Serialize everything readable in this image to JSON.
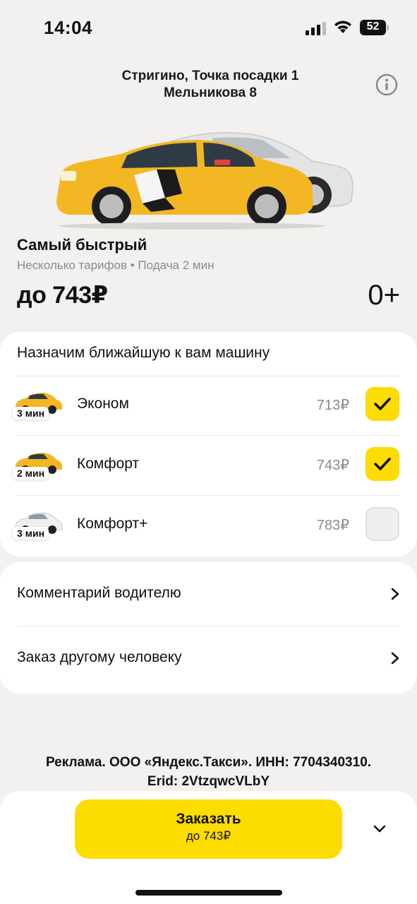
{
  "status": {
    "time": "14:04",
    "battery": "52"
  },
  "header": {
    "route_line1": "Стригино, Точка посадки 1",
    "route_line2": "Мельникова 8"
  },
  "tariff": {
    "title": "Самый быстрый",
    "subtitle": "Несколько тарифов • Подача 2 мин",
    "price": "до 743₽",
    "age": "0+"
  },
  "tariffs_card": {
    "heading": "Назначим ближайшую к вам машину",
    "rows": [
      {
        "name": "Эконом",
        "price": "713₽",
        "time": "3 мин",
        "checked": true,
        "car_color": "yellow"
      },
      {
        "name": "Комфорт",
        "price": "743₽",
        "time": "2 мин",
        "checked": true,
        "car_color": "yellow"
      },
      {
        "name": "Комфорт+",
        "price": "783₽",
        "time": "3 мин",
        "checked": false,
        "car_color": "white"
      }
    ]
  },
  "options": {
    "comment": "Комментарий водителю",
    "other_person": "Заказ другому человеку"
  },
  "ad": {
    "line1": "Реклама. ООО «Яндекс.Такси». ИНН: 7704340310.",
    "line2": "Erid: 2VtzqwcVLbY"
  },
  "order": {
    "label": "Заказать",
    "price": "до 743₽"
  },
  "colors": {
    "accent": "#fddc00",
    "background": "#f2f1ef",
    "muted_text": "#8a8a8a"
  }
}
